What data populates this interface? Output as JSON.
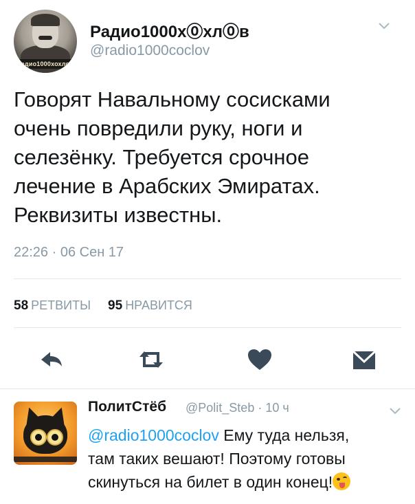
{
  "tweet": {
    "author_name": "Радио1000х⓪хл⓪в",
    "author_handle": "@radio1000coclov",
    "avatar_banner": "радио1000хохлов",
    "text_lines": [
      "Говорят Навальному сосисками",
      "очень повредили руку, ноги и",
      "селезёнку. Требуется срочное",
      "лечение в Арабских Эмиратах.",
      "Реквизиты известны."
    ],
    "timestamp": "22:26 · 06 Сен 17",
    "retweets_count": "58",
    "retweets_label": "РЕТВИТЫ",
    "likes_count": "95",
    "likes_label": "НРАВИТСЯ",
    "actions": [
      "reply-icon",
      "retweet-icon",
      "heart-icon",
      "direct-message-icon"
    ]
  },
  "reply": {
    "author_name": "ПолитСтёб",
    "author_handle": "@Polit_Steb",
    "time": "· 10 ч",
    "mention": "@radio1000coclov",
    "line1_rest": " Ему туда нельзя,",
    "line2": "там таких вешают! Поэтому готовы",
    "line3": "скинуться на билет в один конец!",
    "emoji": "winking-face-with-tongue"
  },
  "colors": {
    "accent": "#1da1f2",
    "icon": "#3b4a59",
    "secondary_text": "#8899a6",
    "divider": "#e1e8ed"
  }
}
